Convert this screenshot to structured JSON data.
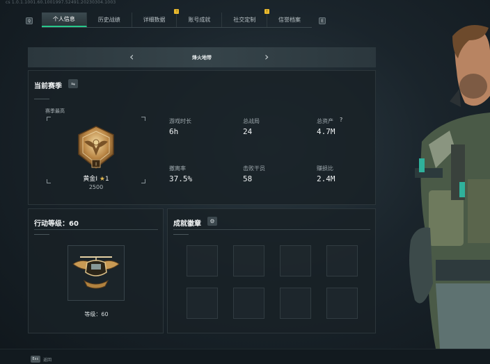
{
  "header": {
    "build": "cs 1.0.1.1001.60.1001997.52491.20230304.1003",
    "left_key": "Q",
    "right_key": "E",
    "tabs": [
      {
        "label": "个人信息",
        "active": true,
        "badge": ""
      },
      {
        "label": "历史战绩",
        "active": false,
        "badge": ""
      },
      {
        "label": "详细数据",
        "active": false,
        "badge": "!"
      },
      {
        "label": "账号成就",
        "active": false,
        "badge": ""
      },
      {
        "label": "社交定制",
        "active": false,
        "badge": "!"
      },
      {
        "label": "信誉档案",
        "active": false,
        "badge": ""
      }
    ]
  },
  "map_selector": {
    "title": "烽火地带",
    "prev_icon": "chevron-left-icon",
    "next_icon": "chevron-right-icon"
  },
  "season": {
    "title": "当前赛季",
    "highest_label": "赛季最高",
    "rank_name": "黄金I",
    "rank_stars": "1",
    "rank_score": "2500",
    "stats": [
      {
        "label": "游戏时长",
        "value": "6h"
      },
      {
        "label": "总战局",
        "value": "24"
      },
      {
        "label": "总资产",
        "value": "4.7M",
        "help": "?"
      },
      {
        "label": "撤离率",
        "value": "37.5%"
      },
      {
        "label": "击败干员",
        "value": "58"
      },
      {
        "label": "赚损比",
        "value": "2.4M"
      }
    ]
  },
  "level": {
    "title": "行动等级：60",
    "level_text": "等级：60"
  },
  "achievements": {
    "title": "成就徽章"
  },
  "footer": {
    "back_key": "Esc",
    "back_label": "返回"
  },
  "colors": {
    "accent": "#27c98b",
    "badge": "#e9b92d",
    "gold": "#c89a4e"
  }
}
